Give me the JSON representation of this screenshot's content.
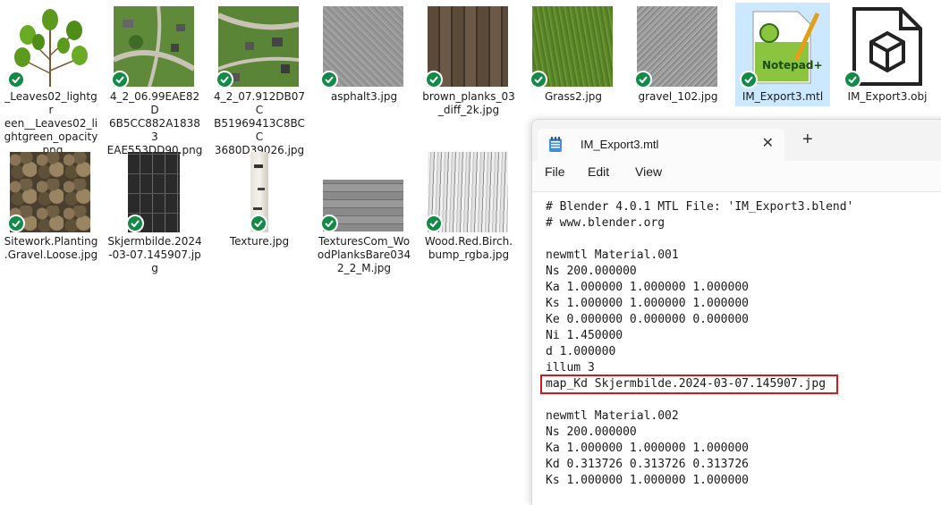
{
  "files": [
    {
      "name": "_Leaves02_lightgreen__Leaves02_lightgreen_opacity.png",
      "label": "_Leaves02_lightgr\neen__Leaves02_li\nghtgreen_opacity\n.png",
      "thumb": "leaves-thumbnail",
      "synced": true
    },
    {
      "name": "4_2_06.99EAE82D6B5CC882A18383EAE553DD90.png",
      "label": "4_2_06.99EAE82D\n6B5CC882A18383\nEAE553DD90.png",
      "thumb": "aerial-map-thumbnail",
      "synced": true
    },
    {
      "name": "4_2_07.912DB07CB51969413C8BCC3680D39026.jpg",
      "label": "4_2_07.912DB07C\nB51969413C8BCC\n3680D39026.jpg",
      "thumb": "aerial-map-thumbnail",
      "synced": true
    },
    {
      "name": "asphalt3.jpg",
      "label": "asphalt3.jpg",
      "thumb": "asphalt-thumbnail",
      "synced": true
    },
    {
      "name": "brown_planks_03_diff_2k.jpg",
      "label": "brown_planks_03\n_diff_2k.jpg",
      "thumb": "planks-thumbnail",
      "synced": true
    },
    {
      "name": "Grass2.jpg",
      "label": "Grass2.jpg",
      "thumb": "grass-thumbnail",
      "synced": true
    },
    {
      "name": "gravel_102.jpg",
      "label": "gravel_102.jpg",
      "thumb": "gravel-thumbnail",
      "synced": true
    },
    {
      "name": "IM_Export3.mtl",
      "label": "IM_Export3.mtl",
      "thumb": "notepadpp-icon",
      "synced": true,
      "selected": true
    },
    {
      "name": "IM_Export3.obj",
      "label": "IM_Export3.obj",
      "thumb": "3d-object-file-icon",
      "synced": true
    },
    {
      "name": "Sitework.Planting.Gravel.Loose.jpg",
      "label": "Sitework.Planting\n.Gravel.Loose.jpg",
      "thumb": "stones-thumbnail",
      "synced": true
    },
    {
      "name": "Skjermbilde.2024-03-07.145907.jpg",
      "label": "Skjermbilde.2024\n-03-07.145907.jp\ng",
      "thumb": "solar-panel-thumbnail",
      "synced": true
    },
    {
      "name": "Texture.jpg",
      "label": "Texture.jpg",
      "thumb": "birch-thumbnail",
      "synced": true
    },
    {
      "name": "TexturesCom_WoodPlanksBare0342_2_M.jpg",
      "label": "TexturesCom_Wo\nodPlanksBare034\n2_2_M.jpg",
      "thumb": "grey-planks-thumbnail",
      "synced": true
    },
    {
      "name": "Wood.Red.Birch.bump_rgba.jpg",
      "label": "Wood.Red.Birch.\nbump_rgba.jpg",
      "thumb": "birch-bump-thumbnail",
      "synced": true
    }
  ],
  "notepad": {
    "tab_title": "IM_Export3.mtl",
    "close_glyph": "✕",
    "new_tab_glyph": "+",
    "menu": [
      "File",
      "Edit",
      "View"
    ],
    "lines": [
      "# Blender 4.0.1 MTL File: 'IM_Export3.blend'",
      "# www.blender.org",
      "",
      "newmtl Material.001",
      "Ns 200.000000",
      "Ka 1.000000 1.000000 1.000000",
      "Ks 1.000000 1.000000 1.000000",
      "Ke 0.000000 0.000000 0.000000",
      "Ni 1.450000",
      "d 1.000000",
      "illum 3",
      "map_Kd Skjermbilde.2024-03-07.145907.jpg",
      "",
      "newmtl Material.002",
      "Ns 200.000000",
      "Ka 1.000000 1.000000 1.000000",
      "Kd 0.313726 0.313726 0.313726",
      "Ks 1.000000 1.000000 1.000000"
    ],
    "highlighted_line_index": 11
  },
  "colors": {
    "sync_check": "#138a47",
    "selection": "#cce8ff",
    "highlight_border": "#d0191c"
  }
}
